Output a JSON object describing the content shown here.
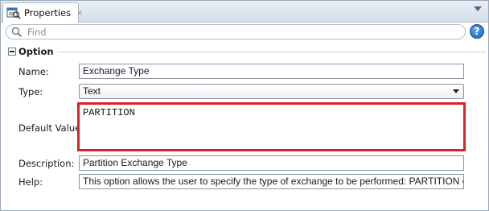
{
  "panel": {
    "tab_label": "Properties",
    "tab_close": "×"
  },
  "search": {
    "placeholder": "Find",
    "help_label": "?"
  },
  "section": {
    "title": "Option"
  },
  "form": {
    "name_label": "Name:",
    "name_value": "Exchange Type",
    "type_label": "Type:",
    "type_value": "Text",
    "default_label": "Default Value:",
    "default_value": "PARTITION",
    "description_label": "Description:",
    "description_value": "Partition Exchange Type",
    "help_label": "Help:",
    "help_value": "This option allows the user to specify the type of exchange to be performed:  PARTITION or SUBP"
  },
  "colors": {
    "highlight_border": "#dd1f2a",
    "help_button": "#1c5fb8"
  },
  "icons": [
    "properties-icon",
    "close-icon",
    "panel-menu-icon",
    "search-icon",
    "help-icon",
    "collapse-icon",
    "dropdown-arrow-icon"
  ]
}
